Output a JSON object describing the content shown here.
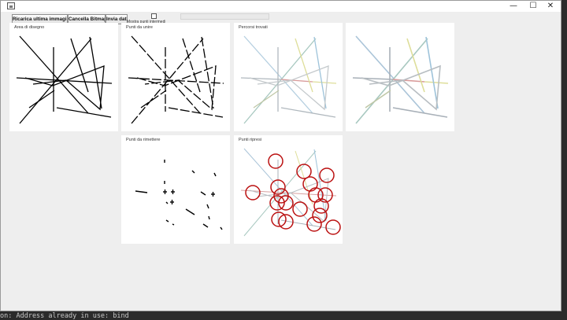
{
  "window": {
    "minimize_glyph": "—",
    "maximize_glyph": "☐",
    "close_glyph": "✕"
  },
  "toolbar": {
    "reload_label": "Ricarica ultima immagine",
    "clear_label": "Cancella Bitmap",
    "send_label": "Invia dati",
    "checkbox_label": "Mostra punti intermedi"
  },
  "panels": {
    "drawing_title": "Area di disegno",
    "join_title": "Punti da unire",
    "paths_title": "Percorsi trovati",
    "overlay_title": "",
    "remove_title": "Punti da rimettere",
    "recovered_title": "Punti ripresi"
  },
  "colors": {
    "path_gray": "#b0b8be",
    "path_yellow": "#dede9a",
    "path_red": "#d89a9a",
    "path_blue": "#9ec3da",
    "circle_red": "#bb1111"
  },
  "console": {
    "line": "on: Address already in use: bind"
  }
}
